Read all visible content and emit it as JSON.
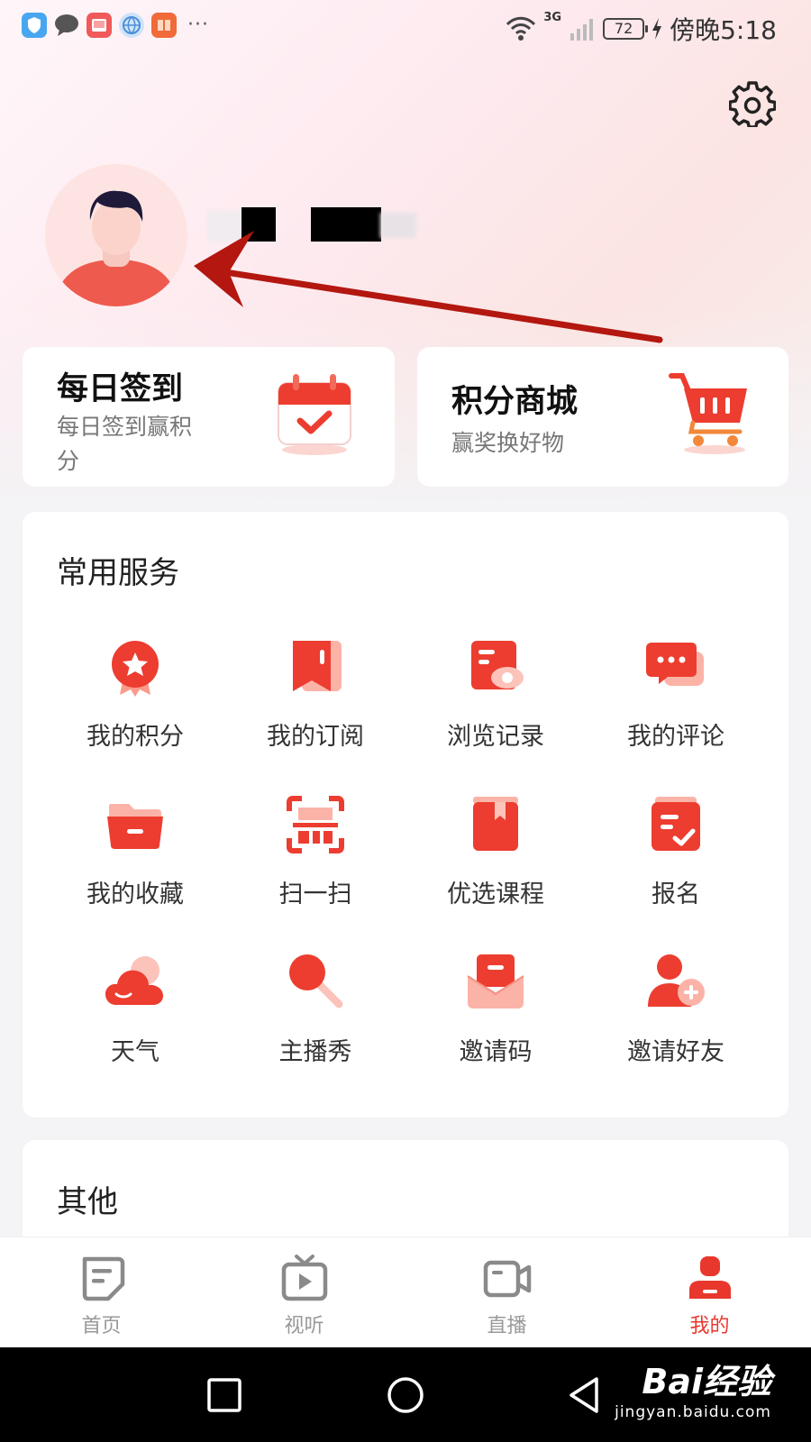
{
  "status_bar": {
    "app_icons": [
      "shield-icon",
      "message-icon",
      "gallery-icon",
      "browser-icon",
      "news-app-icon"
    ],
    "more": "···",
    "network": "3G",
    "battery": "72",
    "time": "傍晚5:18"
  },
  "profile": {
    "username": ""
  },
  "cards": {
    "daily_checkin": {
      "title": "每日签到",
      "subtitle_line1": "每日签到赢积",
      "subtitle_line2": "分"
    },
    "points_mall": {
      "title": "积分商城",
      "subtitle": "赢奖换好物"
    }
  },
  "services": {
    "title": "常用服务",
    "items": [
      {
        "label": "我的积分",
        "icon": "points-medal-icon"
      },
      {
        "label": "我的订阅",
        "icon": "bookmark-icon"
      },
      {
        "label": "浏览记录",
        "icon": "history-eye-icon"
      },
      {
        "label": "我的评论",
        "icon": "comment-bubble-icon"
      },
      {
        "label": "我的收藏",
        "icon": "folder-icon"
      },
      {
        "label": "扫一扫",
        "icon": "scan-icon"
      },
      {
        "label": "优选课程",
        "icon": "course-book-icon"
      },
      {
        "label": "报名",
        "icon": "signup-checklist-icon"
      },
      {
        "label": "天气",
        "icon": "weather-cloud-icon"
      },
      {
        "label": "主播秀",
        "icon": "microphone-icon"
      },
      {
        "label": "邀请码",
        "icon": "invite-envelope-icon"
      },
      {
        "label": "邀请好友",
        "icon": "add-friend-icon"
      }
    ]
  },
  "other": {
    "title": "其他"
  },
  "tabs": [
    {
      "label": "首页",
      "icon": "home-doc-icon",
      "active": false
    },
    {
      "label": "视听",
      "icon": "video-play-icon",
      "active": false
    },
    {
      "label": "直播",
      "icon": "live-camera-icon",
      "active": false
    },
    {
      "label": "我的",
      "icon": "profile-icon",
      "active": true
    }
  ],
  "watermark": {
    "main": "Bai经验",
    "sub": "jingyan.baidu.com"
  },
  "colors": {
    "accent": "#e8382d",
    "accent_light": "#fb7a66",
    "icon_gray": "#8a8a8a"
  }
}
